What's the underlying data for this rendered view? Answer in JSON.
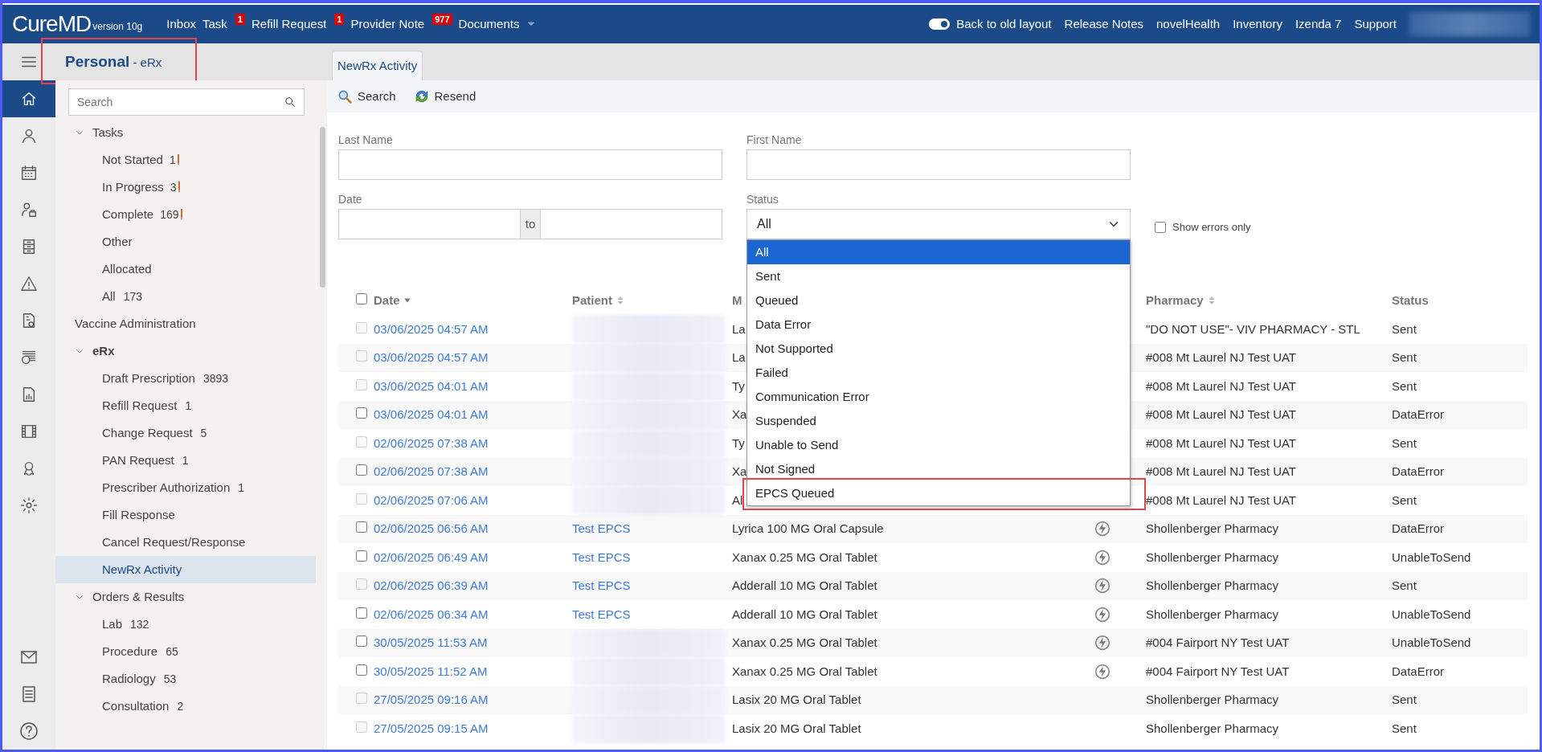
{
  "app": {
    "logo": "CureMD",
    "version": "version 10g"
  },
  "top_nav": [
    {
      "label": "Inbox",
      "dropdown": false
    },
    {
      "label": "Task",
      "badge": "1",
      "dropdown": false
    },
    {
      "label": "Refill Request",
      "badge": "1",
      "dropdown": false
    },
    {
      "label": "Provider Note",
      "badge": "977",
      "dropdown": false
    },
    {
      "label": "Documents",
      "dropdown": true
    }
  ],
  "layout_toggle": {
    "label": "Back to old layout",
    "on": true
  },
  "top_links": [
    "Release Notes",
    "novelHealth",
    "Inventory",
    "Izenda 7",
    "Support"
  ],
  "page_title": {
    "title": "Personal",
    "subtitle": "- eRx",
    "highlighted": true
  },
  "tabs": [
    {
      "label": "NewRx Activity",
      "selected": true
    }
  ],
  "rail": [
    {
      "selected": true
    },
    {
      "selected": false
    },
    {
      "selected": false
    },
    {
      "selected": false
    },
    {
      "selected": false
    },
    {
      "selected": false
    },
    {
      "selected": false
    },
    {
      "selected": false
    },
    {
      "selected": false
    },
    {
      "selected": false
    },
    {
      "selected": false
    },
    {
      "selected": false
    }
  ],
  "sidebar": {
    "search_placeholder": "Search",
    "groups": [
      {
        "kind": "group",
        "label": "Tasks",
        "expanded": true,
        "items": [
          {
            "label": "Not Started",
            "count": "1",
            "alert": true,
            "selected": false
          },
          {
            "label": "In Progress",
            "count": "3",
            "alert": true,
            "selected": false
          },
          {
            "label": "Complete",
            "count": "169",
            "alert": true,
            "selected": false
          },
          {
            "label": "Other",
            "alert": false,
            "selected": false
          },
          {
            "label": "Allocated",
            "alert": false,
            "selected": false
          },
          {
            "label": "All",
            "count": "173",
            "alert": false,
            "selected": false
          }
        ]
      },
      {
        "kind": "link",
        "label": "Vaccine Administration"
      },
      {
        "kind": "group",
        "label": "eRx",
        "expanded": true,
        "items": [
          {
            "label": "Draft Prescription",
            "count": "3893",
            "alert": false,
            "selected": false
          },
          {
            "label": "Refill Request",
            "count": "1",
            "alert": false,
            "selected": false
          },
          {
            "label": "Change Request",
            "count": "5",
            "alert": false,
            "selected": false
          },
          {
            "label": "PAN Request",
            "count": "1",
            "alert": false,
            "selected": false
          },
          {
            "label": "Prescriber Authorization",
            "count": "1",
            "alert": false,
            "selected": false
          },
          {
            "label": "Fill Response",
            "alert": false,
            "selected": false
          },
          {
            "label": "Cancel Request/Response",
            "alert": false,
            "selected": false
          },
          {
            "label": "NewRx Activity",
            "alert": false,
            "selected": true
          }
        ]
      },
      {
        "kind": "group",
        "label": "Orders & Results",
        "expanded": true,
        "items": [
          {
            "label": "Lab",
            "count": "132",
            "alert": false,
            "selected": false
          },
          {
            "label": "Procedure",
            "count": "65",
            "alert": false,
            "selected": false
          },
          {
            "label": "Radiology",
            "count": "53",
            "alert": false,
            "selected": false
          },
          {
            "label": "Consultation",
            "count": "2",
            "alert": false,
            "selected": false
          }
        ]
      }
    ]
  },
  "toolbar": [
    {
      "kind": "search",
      "label": "Search"
    },
    {
      "kind": "resend",
      "label": "Resend"
    }
  ],
  "filters": {
    "last_name": {
      "label": "Last Name"
    },
    "first_name": {
      "label": "First Name"
    },
    "date": {
      "label": "Date",
      "separator": "to"
    },
    "status": {
      "label": "Status",
      "value": "All",
      "open": true,
      "options": [
        {
          "label": "All",
          "selected": true,
          "highlighted": false
        },
        {
          "label": "Sent",
          "selected": false,
          "highlighted": false
        },
        {
          "label": "Queued",
          "selected": false,
          "highlighted": false
        },
        {
          "label": "Data Error",
          "selected": false,
          "highlighted": false
        },
        {
          "label": "Not Supported",
          "selected": false,
          "highlighted": false
        },
        {
          "label": "Failed",
          "selected": false,
          "highlighted": false
        },
        {
          "label": "Communication Error",
          "selected": false,
          "highlighted": false
        },
        {
          "label": "Suspended",
          "selected": false,
          "highlighted": false
        },
        {
          "label": "Unable to Send",
          "selected": false,
          "highlighted": false
        },
        {
          "label": "Not Signed",
          "selected": false,
          "highlighted": false
        },
        {
          "label": "EPCS Queued",
          "selected": false,
          "highlighted": true
        }
      ]
    },
    "errors_only": {
      "label": "Show errors only",
      "checked": false
    }
  },
  "table": {
    "select_all": {
      "checked": false
    },
    "columns": [
      {
        "label": "Date",
        "sortable": true,
        "sorted": true
      },
      {
        "label": "Patient",
        "sortable": true,
        "sorted": false
      },
      {
        "label": "M",
        "sortable": false,
        "sorted": false
      },
      {
        "label": "Pharmacy",
        "sortable": true,
        "sorted": false
      },
      {
        "label": "Status",
        "sortable": false,
        "sorted": false
      }
    ],
    "rows": [
      {
        "date": "03/06/2025 04:57 AM",
        "medication": "La",
        "epcs": false,
        "pharmacy": "\"DO NOT USE\"- VIV PHARMACY - STL",
        "status": "Sent",
        "disabled": true
      },
      {
        "date": "03/06/2025 04:57 AM",
        "medication": "La",
        "epcs": false,
        "pharmacy": "#008 Mt Laurel NJ Test UAT",
        "status": "Sent",
        "disabled": true
      },
      {
        "date": "03/06/2025 04:01 AM",
        "medication": "Ty",
        "epcs": false,
        "pharmacy": "#008 Mt Laurel NJ Test UAT",
        "status": "Sent",
        "disabled": true
      },
      {
        "date": "03/06/2025 04:01 AM",
        "medication": "Xa",
        "epcs": false,
        "pharmacy": "#008 Mt Laurel NJ Test UAT",
        "status": "DataError",
        "disabled": false
      },
      {
        "date": "02/06/2025 07:38 AM",
        "medication": "Ty",
        "epcs": false,
        "pharmacy": "#008 Mt Laurel NJ Test UAT",
        "status": "Sent",
        "disabled": true
      },
      {
        "date": "02/06/2025 07:38 AM",
        "medication": "Xa",
        "epcs": false,
        "pharmacy": "#008 Mt Laurel NJ Test UAT",
        "status": "DataError",
        "disabled": false
      },
      {
        "date": "02/06/2025 07:06 AM",
        "medication": "Al",
        "epcs": false,
        "pharmacy": "#008 Mt Laurel NJ Test UAT",
        "status": "Sent",
        "disabled": true
      },
      {
        "date": "02/06/2025 06:56 AM",
        "patient": "Test EPCS",
        "medication": "Lyrica 100 MG Oral Capsule",
        "epcs": true,
        "pharmacy": "Shollenberger Pharmacy",
        "status": "DataError",
        "disabled": false
      },
      {
        "date": "02/06/2025 06:49 AM",
        "patient": "Test EPCS",
        "medication": "Xanax 0.25 MG Oral Tablet",
        "epcs": true,
        "pharmacy": "Shollenberger Pharmacy",
        "status": "UnableToSend",
        "disabled": false
      },
      {
        "date": "02/06/2025 06:39 AM",
        "patient": "Test EPCS",
        "medication": "Adderall 10 MG Oral Tablet",
        "epcs": true,
        "pharmacy": "Shollenberger Pharmacy",
        "status": "Sent",
        "disabled": true
      },
      {
        "date": "02/06/2025 06:34 AM",
        "patient": "Test EPCS",
        "medication": "Adderall 10 MG Oral Tablet",
        "epcs": true,
        "pharmacy": "Shollenberger Pharmacy",
        "status": "UnableToSend",
        "disabled": false
      },
      {
        "date": "30/05/2025 11:53 AM",
        "medication": "Xanax 0.25 MG Oral Tablet",
        "epcs": true,
        "pharmacy": "#004 Fairport NY Test UAT",
        "status": "UnableToSend",
        "disabled": false
      },
      {
        "date": "30/05/2025 11:52 AM",
        "medication": "Xanax 0.25 MG Oral Tablet",
        "epcs": true,
        "pharmacy": "#004 Fairport NY Test UAT",
        "status": "DataError",
        "disabled": false
      },
      {
        "date": "27/05/2025 09:16 AM",
        "medication": "Lasix 20 MG Oral Tablet",
        "epcs": false,
        "pharmacy": "Shollenberger Pharmacy",
        "status": "Sent",
        "disabled": true
      },
      {
        "date": "27/05/2025 09:15 AM",
        "medication": "Lasix 20 MG Oral Tablet",
        "epcs": false,
        "pharmacy": "Shollenberger Pharmacy",
        "status": "Sent",
        "disabled": true
      }
    ]
  }
}
